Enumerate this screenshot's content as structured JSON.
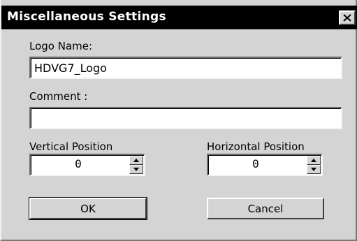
{
  "window": {
    "title": "Miscellaneous Settings",
    "close_icon": "close-icon",
    "close_glyph": "×"
  },
  "logo_name": {
    "label": "Logo Name:",
    "value": "HDVG7_Logo"
  },
  "comment": {
    "label": "Comment :",
    "value": ""
  },
  "vertical_position": {
    "label": "Vertical Position",
    "value": "0"
  },
  "horizontal_position": {
    "label": "Horizontal Position",
    "value": "0"
  },
  "buttons": {
    "ok_label": "OK",
    "cancel_label": "Cancel"
  },
  "colors": {
    "titlebar": "#000000",
    "dialog_face": "#d4d4d4",
    "field_bg": "#ffffff"
  }
}
